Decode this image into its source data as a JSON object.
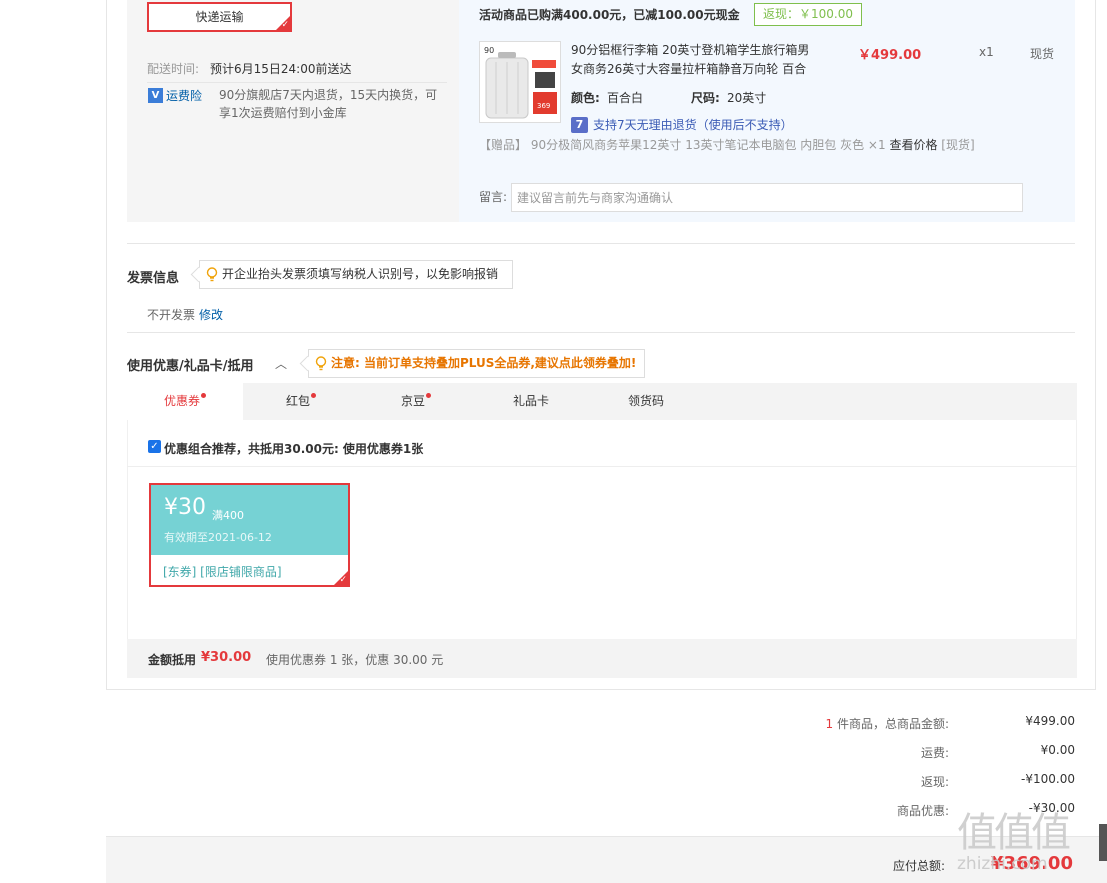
{
  "shipping": {
    "method_label": "快递运输",
    "time_label": "配送时间:",
    "time_value": "预计6月15日24:00前送达",
    "insurance_icon": "shield-v-icon",
    "insurance_label": "运费险",
    "insurance_desc": "90分旗舰店7天内退货，15天内换货，可享1次运费赔付到小金库"
  },
  "promo": {
    "text": "活动商品已购满400.00元，已减100.00元现金",
    "rebate": "返现：￥100.00"
  },
  "product": {
    "name": "90分铝框行李箱 20英寸登机箱学生旅行箱男女商务26英寸大容量拉杆箱静音万向轮 百合",
    "price": "￥499.00",
    "qty": "x1",
    "stock": "现货",
    "color_label": "颜色:",
    "color_value": "百合白",
    "size_label": "尺码:",
    "size_value": "20英寸",
    "return_icon_text": "7",
    "return_text": "支持7天无理由退货（使用后不支持）",
    "gift_prefix": "【赠品】",
    "gift_name": "90分极简风商务苹果12英寸 13英寸笔记本电脑包 内胆包 灰色 ×1",
    "gift_check": "查看价格",
    "gift_stock": "[现货]",
    "note_label": "留言:",
    "note_placeholder": "建议留言前先与商家沟通确认"
  },
  "invoice": {
    "title": "发票信息",
    "tip": "开企业抬头发票须填写纳税人识别号，以免影响报销",
    "status": "不开发票",
    "edit": "修改"
  },
  "discount": {
    "title": "使用优惠/礼品卡/抵用",
    "chevron": "^",
    "tip": "注意: 当前订单支持叠加PLUS全品券,建议点此领券叠加!",
    "tabs": [
      {
        "label": "优惠券",
        "dot": true
      },
      {
        "label": "红包",
        "dot": true
      },
      {
        "label": "京豆",
        "dot": true
      },
      {
        "label": "礼品卡",
        "dot": false
      },
      {
        "label": "领货码",
        "dot": false
      }
    ],
    "combo_text": "优惠组合推荐，共抵用30.00元: 使用优惠券1张",
    "coupon": {
      "amount": "¥30",
      "min": "满400",
      "expiry": "有效期至2021-06-12",
      "tags": "[东券] [限店铺限商品]"
    },
    "summary_label": "金额抵用",
    "summary_amount": "¥30.00",
    "summary_desc": "使用优惠券 1 张，优惠 30.00 元"
  },
  "totals": {
    "count": "1",
    "count_suffix": "件商品，总商品金额:",
    "goods_value": "¥499.00",
    "shipping_label": "运费:",
    "shipping_value": "¥0.00",
    "rebate_label": "返现:",
    "rebate_value": "-¥100.00",
    "discount_label": "商品优惠:",
    "discount_value": "-¥30.00",
    "payable_label": "应付总额:",
    "payable_value": "¥369.00"
  },
  "watermark": {
    "glyphs": "值值值",
    "text": "zhizhi.com"
  }
}
